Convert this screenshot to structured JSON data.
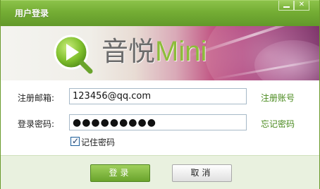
{
  "window": {
    "title": "用户登录",
    "minimize_label": "",
    "close_label": "✕"
  },
  "banner": {
    "brand_cn": "音悦",
    "brand_en": "Mini"
  },
  "form": {
    "email_label": "注册邮箱:",
    "email_value": "123456@qq.com",
    "register_link": "注册账号",
    "password_label": "登录密码:",
    "password_value": "●●●●●●●●●",
    "forgot_link": "忘记密码",
    "remember_label": "记住密码",
    "remember_checked": true
  },
  "buttons": {
    "login": "登录",
    "cancel": "取消"
  },
  "colors": {
    "titlebar": "#74ad34",
    "accent_green": "#8dbd3a",
    "link_green": "#4a8a1e",
    "footer_bg": "#e9f1df"
  }
}
